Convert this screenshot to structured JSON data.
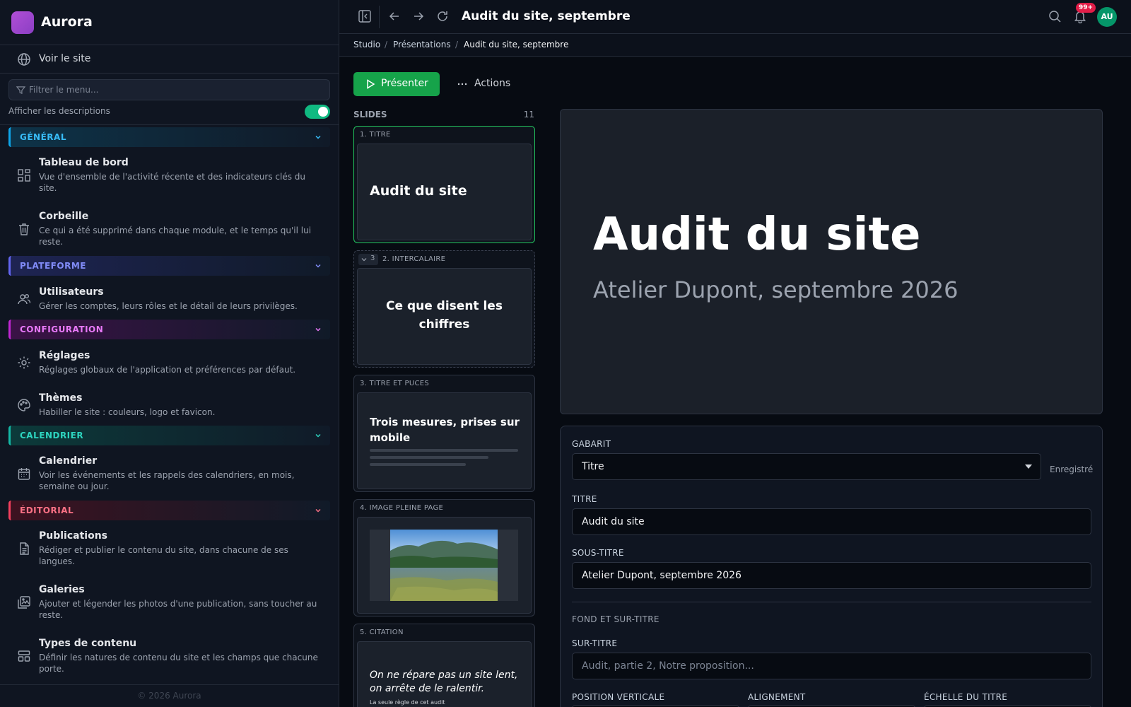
{
  "app": {
    "name": "Aurora",
    "copyright": "© 2026 Aurora"
  },
  "sidebar": {
    "view_site": "Voir le site",
    "filter_placeholder": "Filtrer le menu...",
    "show_descriptions": "Afficher les descriptions",
    "sections": [
      {
        "label": "GÉNÉRAL",
        "color": "#0ea5e9",
        "items": [
          {
            "title": "Tableau de bord",
            "desc": "Vue d'ensemble de l'activité récente et des indicateurs clés du site.",
            "icon": "dashboard-icon"
          },
          {
            "title": "Corbeille",
            "desc": "Ce qui a été supprimé dans chaque module, et le temps qu'il lui reste.",
            "icon": "trash-icon"
          }
        ]
      },
      {
        "label": "PLATEFORME",
        "color": "#6366f1",
        "items": [
          {
            "title": "Utilisateurs",
            "desc": "Gérer les comptes, leurs rôles et le détail de leurs privilèges.",
            "icon": "users-icon"
          }
        ]
      },
      {
        "label": "CONFIGURATION",
        "color": "#c026d3",
        "items": [
          {
            "title": "Réglages",
            "desc": "Réglages globaux de l'application et préférences par défaut.",
            "icon": "gear-icon"
          },
          {
            "title": "Thèmes",
            "desc": "Habiller le site : couleurs, logo et favicon.",
            "icon": "palette-icon"
          }
        ]
      },
      {
        "label": "CALENDRIER",
        "color": "#14b8a6",
        "items": [
          {
            "title": "Calendrier",
            "desc": "Voir les événements et les rappels des calendriers, en mois, semaine ou jour.",
            "icon": "calendar-icon"
          }
        ]
      },
      {
        "label": "ÉDITORIAL",
        "color": "#f43f5e",
        "items": [
          {
            "title": "Publications",
            "desc": "Rédiger et publier le contenu du site, dans chacune de ses langues.",
            "icon": "document-icon"
          },
          {
            "title": "Galeries",
            "desc": "Ajouter et légender les photos d'une publication, sans toucher au reste.",
            "icon": "gallery-icon"
          },
          {
            "title": "Types de contenu",
            "desc": "Définir les natures de contenu du site et les champs que chacune porte.",
            "icon": "layout-icon"
          }
        ]
      }
    ]
  },
  "topbar": {
    "title": "Audit du site, septembre",
    "notifications": "99+",
    "avatar": "AU"
  },
  "breadcrumb": [
    "Studio",
    "/",
    "Présentations",
    "/",
    "Audit du site, septembre"
  ],
  "toolbar": {
    "present": "Présenter",
    "actions": "Actions"
  },
  "slides": {
    "heading": "SLIDES",
    "count": "11",
    "collapse_count": "3",
    "items": [
      {
        "caption": "1. TITRE",
        "text": "Audit du site"
      },
      {
        "caption": "2. INTERCALAIRE",
        "text": "Ce que disent les chiffres"
      },
      {
        "caption": "3. TITRE ET PUCES",
        "text": "Trois mesures, prises sur mobile"
      },
      {
        "caption": "4. IMAGE PLEINE PAGE",
        "text": ""
      },
      {
        "caption": "5. CITATION",
        "text": "On ne répare pas un site lent, on arrête de le ralentir.",
        "sub": "La seule règle de cet audit"
      }
    ]
  },
  "preview": {
    "title": "Audit du site",
    "subtitle": "Atelier Dupont, septembre 2026"
  },
  "form": {
    "template_label": "GABARIT",
    "template_value": "Titre",
    "saved": "Enregistré",
    "title_label": "TITRE",
    "title_value": "Audit du site",
    "subtitle_label": "SOUS-TITRE",
    "subtitle_value": "Atelier Dupont, septembre 2026",
    "section_label": "FOND ET SUR-TITRE",
    "overtitle_label": "SUR-TITRE",
    "overtitle_placeholder": "Audit, partie 2, Notre proposition...",
    "vpos_label": "POSITION VERTICALE",
    "align_label": "ALIGNEMENT",
    "scale_label": "ÉCHELLE DU TITRE"
  }
}
